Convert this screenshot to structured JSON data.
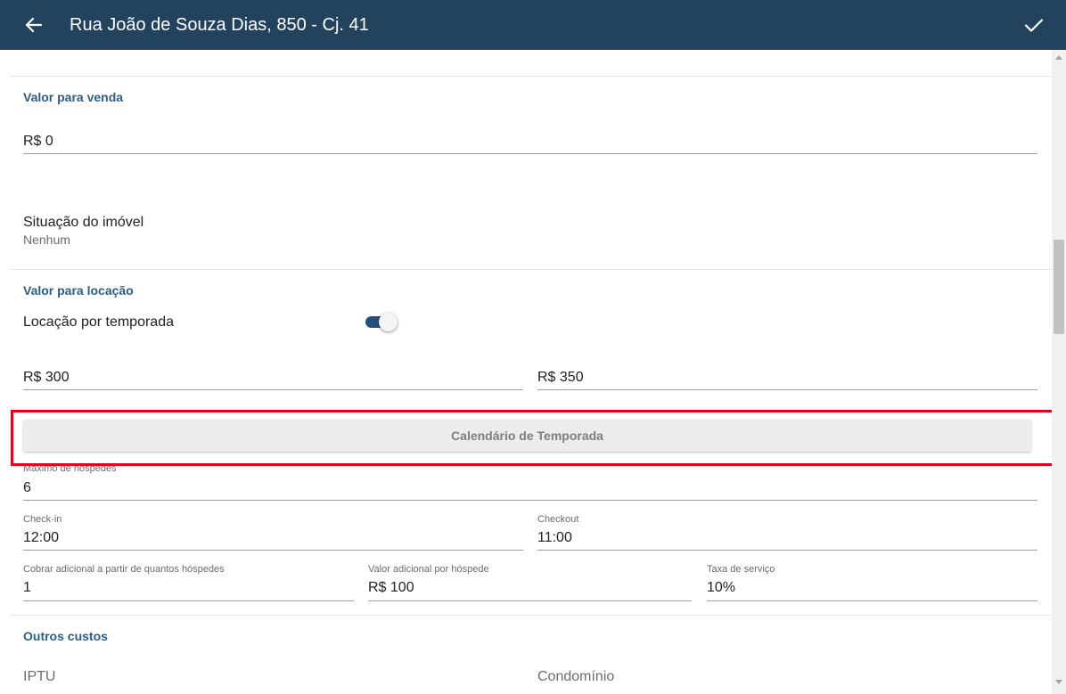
{
  "appbar": {
    "title": "Rua João de Souza Dias, 850 - Cj. 41",
    "back_icon": "arrow-left-icon",
    "confirm_icon": "check-icon",
    "color": "#22425e"
  },
  "sale": {
    "section_title": "Valor para venda",
    "price_value": "R$ 0"
  },
  "property_status": {
    "label": "Situação do imóvel",
    "value": "Nenhum"
  },
  "rent": {
    "section_title": "Valor para locação",
    "seasonal_label": "Locação por temporada",
    "seasonal_enabled": true,
    "price_1": "R$ 300",
    "price_2": "R$ 350",
    "calendar_button": "Calendário de Temporada",
    "max_guests_label": "Máximo de hóspedes",
    "max_guests_value": "6",
    "checkin_label": "Check-in",
    "checkin_value": "12:00",
    "checkout_label": "Checkout",
    "checkout_value": "11:00",
    "extra_from_label": "Cobrar adicional a partir de quantos hóspedes",
    "extra_from_value": "1",
    "extra_value_label": "Valor adicional por hóspede",
    "extra_value_value": "R$ 100",
    "service_fee_label": "Taxa de serviço",
    "service_fee_value": "10%"
  },
  "other_costs": {
    "section_title": "Outros custos",
    "iptu_label": "IPTU",
    "condo_label": "Condomínio"
  },
  "colors": {
    "accent": "#2c5e86",
    "highlight": "#e3001b"
  }
}
